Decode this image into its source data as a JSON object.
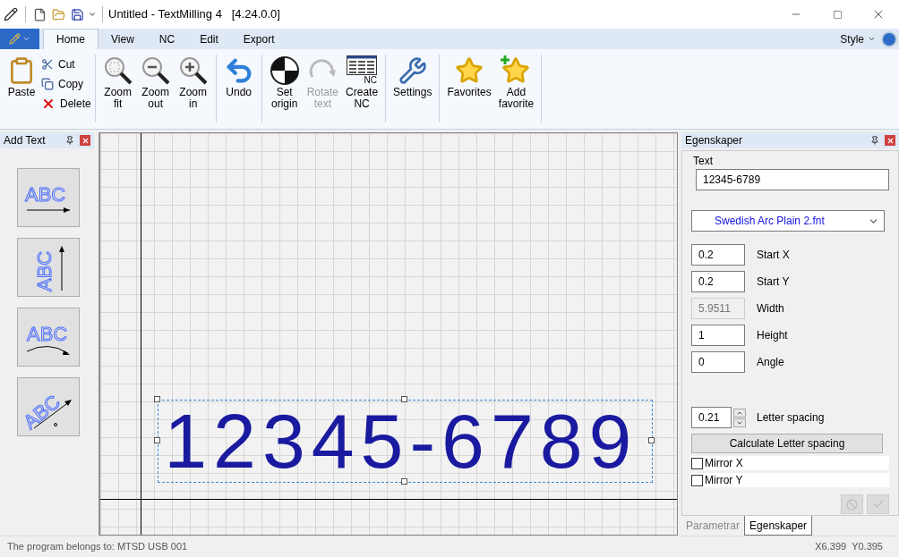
{
  "window": {
    "title": "Untitled - TextMilling 4   [4.24.0.0]"
  },
  "ribbon_tabs": [
    {
      "label": "Home",
      "selected": true
    },
    {
      "label": "View",
      "selected": false
    },
    {
      "label": "NC",
      "selected": false
    },
    {
      "label": "Edit",
      "selected": false
    },
    {
      "label": "Export",
      "selected": false
    }
  ],
  "style_menu": {
    "label": "Style"
  },
  "ribbon_groups": [
    {
      "items": [
        {
          "kind": "large",
          "label": "Paste",
          "disabled": false
        },
        {
          "kind": "small",
          "label": "Cut",
          "disabled": false
        },
        {
          "kind": "small",
          "label": "Copy",
          "disabled": false
        },
        {
          "kind": "small",
          "label": "Delete",
          "disabled": false
        }
      ]
    },
    {
      "items": [
        {
          "kind": "large",
          "label": "Zoom\nfit",
          "disabled": false
        },
        {
          "kind": "large",
          "label": "Zoom\nout",
          "disabled": false
        },
        {
          "kind": "large",
          "label": "Zoom\nin",
          "disabled": false
        }
      ]
    },
    {
      "items": [
        {
          "kind": "large",
          "label": "Undo",
          "disabled": false
        }
      ]
    },
    {
      "items": [
        {
          "kind": "large",
          "label": "Set\norigin",
          "disabled": false
        },
        {
          "kind": "large",
          "label": "Rotate\ntext",
          "disabled": true
        },
        {
          "kind": "large",
          "label": "Create\nNC",
          "icon_text": "NC",
          "disabled": false
        }
      ]
    },
    {
      "items": [
        {
          "kind": "large",
          "label": "Settings",
          "disabled": false
        }
      ]
    },
    {
      "items": [
        {
          "kind": "large",
          "label": "Favorites",
          "disabled": false
        },
        {
          "kind": "large",
          "label": "Add\nfavorite",
          "disabled": false
        }
      ]
    }
  ],
  "add_text_panel": {
    "title": "Add Text",
    "tools": [
      {
        "kind": "straight",
        "sample": "ABC"
      },
      {
        "kind": "vertical",
        "sample": "ABC"
      },
      {
        "kind": "arc",
        "sample": "ABC"
      },
      {
        "kind": "angled",
        "sample": "ABC"
      }
    ]
  },
  "canvas": {
    "text": "12345-6789"
  },
  "properties_panel": {
    "title": "Egenskaper",
    "text_label": "Text",
    "text_value": "12345-6789",
    "font": "Swedish Arc Plain 2.fnt",
    "fields": [
      {
        "label": "Start X",
        "value": "0.2",
        "disabled": false
      },
      {
        "label": "Start Y",
        "value": "0.2",
        "disabled": false
      },
      {
        "label": "Width",
        "value": "5.9511",
        "disabled": true
      },
      {
        "label": "Height",
        "value": "1",
        "disabled": false
      },
      {
        "label": "Angle",
        "value": "0",
        "disabled": false
      }
    ],
    "letter_spacing": {
      "label": "Letter spacing",
      "value": "0.21"
    },
    "calculate_button": "Calculate Letter spacing",
    "checkboxes": [
      {
        "label": "Mirror X",
        "checked": false
      },
      {
        "label": "Mirror Y",
        "checked": false
      }
    ],
    "bottom_tabs": [
      {
        "label": "Parametrar",
        "selected": false
      },
      {
        "label": "Egenskaper",
        "selected": true
      }
    ]
  },
  "status_bar": {
    "owner": "The program belongs to: MTSD USB 001",
    "x": "X6.399",
    "y": "Y0.395"
  }
}
